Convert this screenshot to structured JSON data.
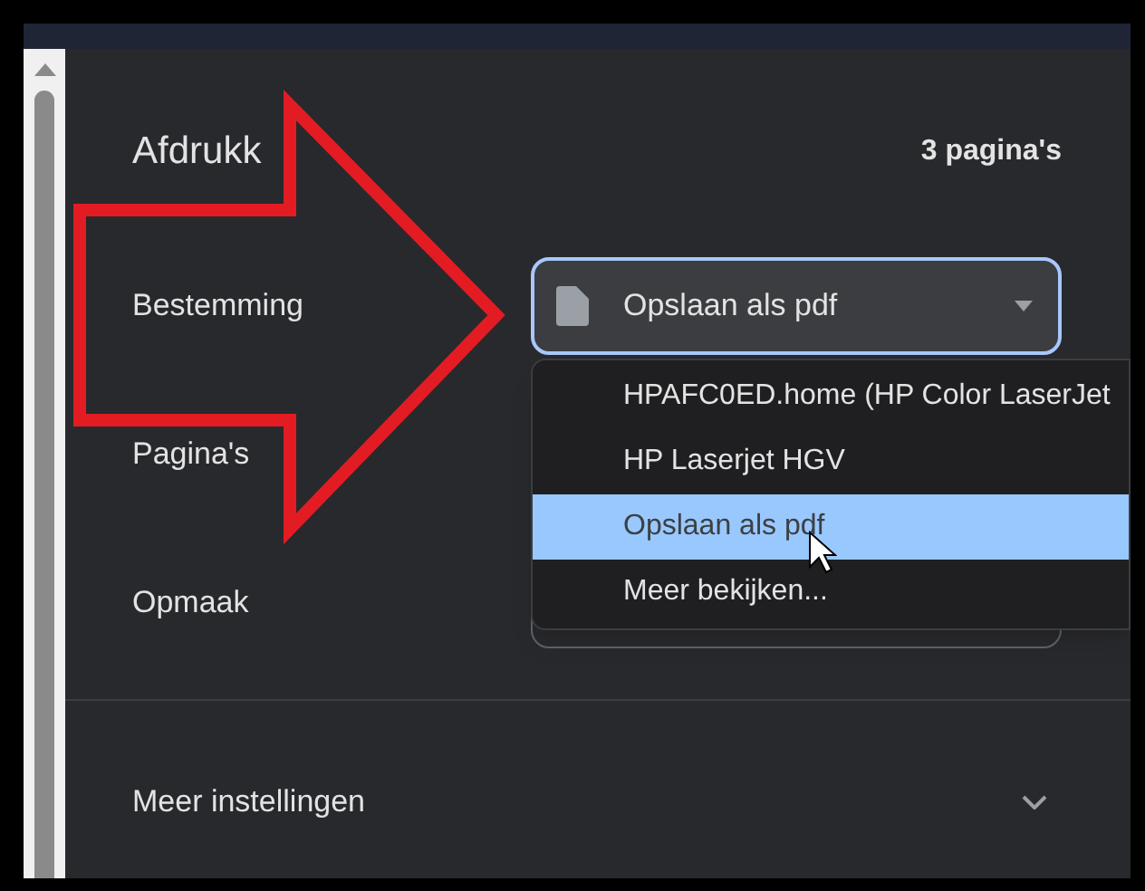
{
  "header": {
    "title": "Afdrukk",
    "page_count": "3 pagina's"
  },
  "settings": [
    {
      "label": "Bestemming",
      "kind": "select",
      "value": "Opslaan als pdf"
    },
    {
      "label": "Pagina's",
      "kind": "covered"
    },
    {
      "label": "Opmaak",
      "kind": "field"
    }
  ],
  "dropdown": {
    "options": [
      {
        "label": "HPAFC0ED.home (HP Color LaserJet",
        "selected": false
      },
      {
        "label": "HP Laserjet HGV",
        "selected": false
      },
      {
        "label": "Opslaan als pdf",
        "selected": true
      },
      {
        "label": "Meer bekijken...",
        "selected": false
      }
    ]
  },
  "more_settings": {
    "label": "Meer instellingen",
    "expanded": false
  }
}
